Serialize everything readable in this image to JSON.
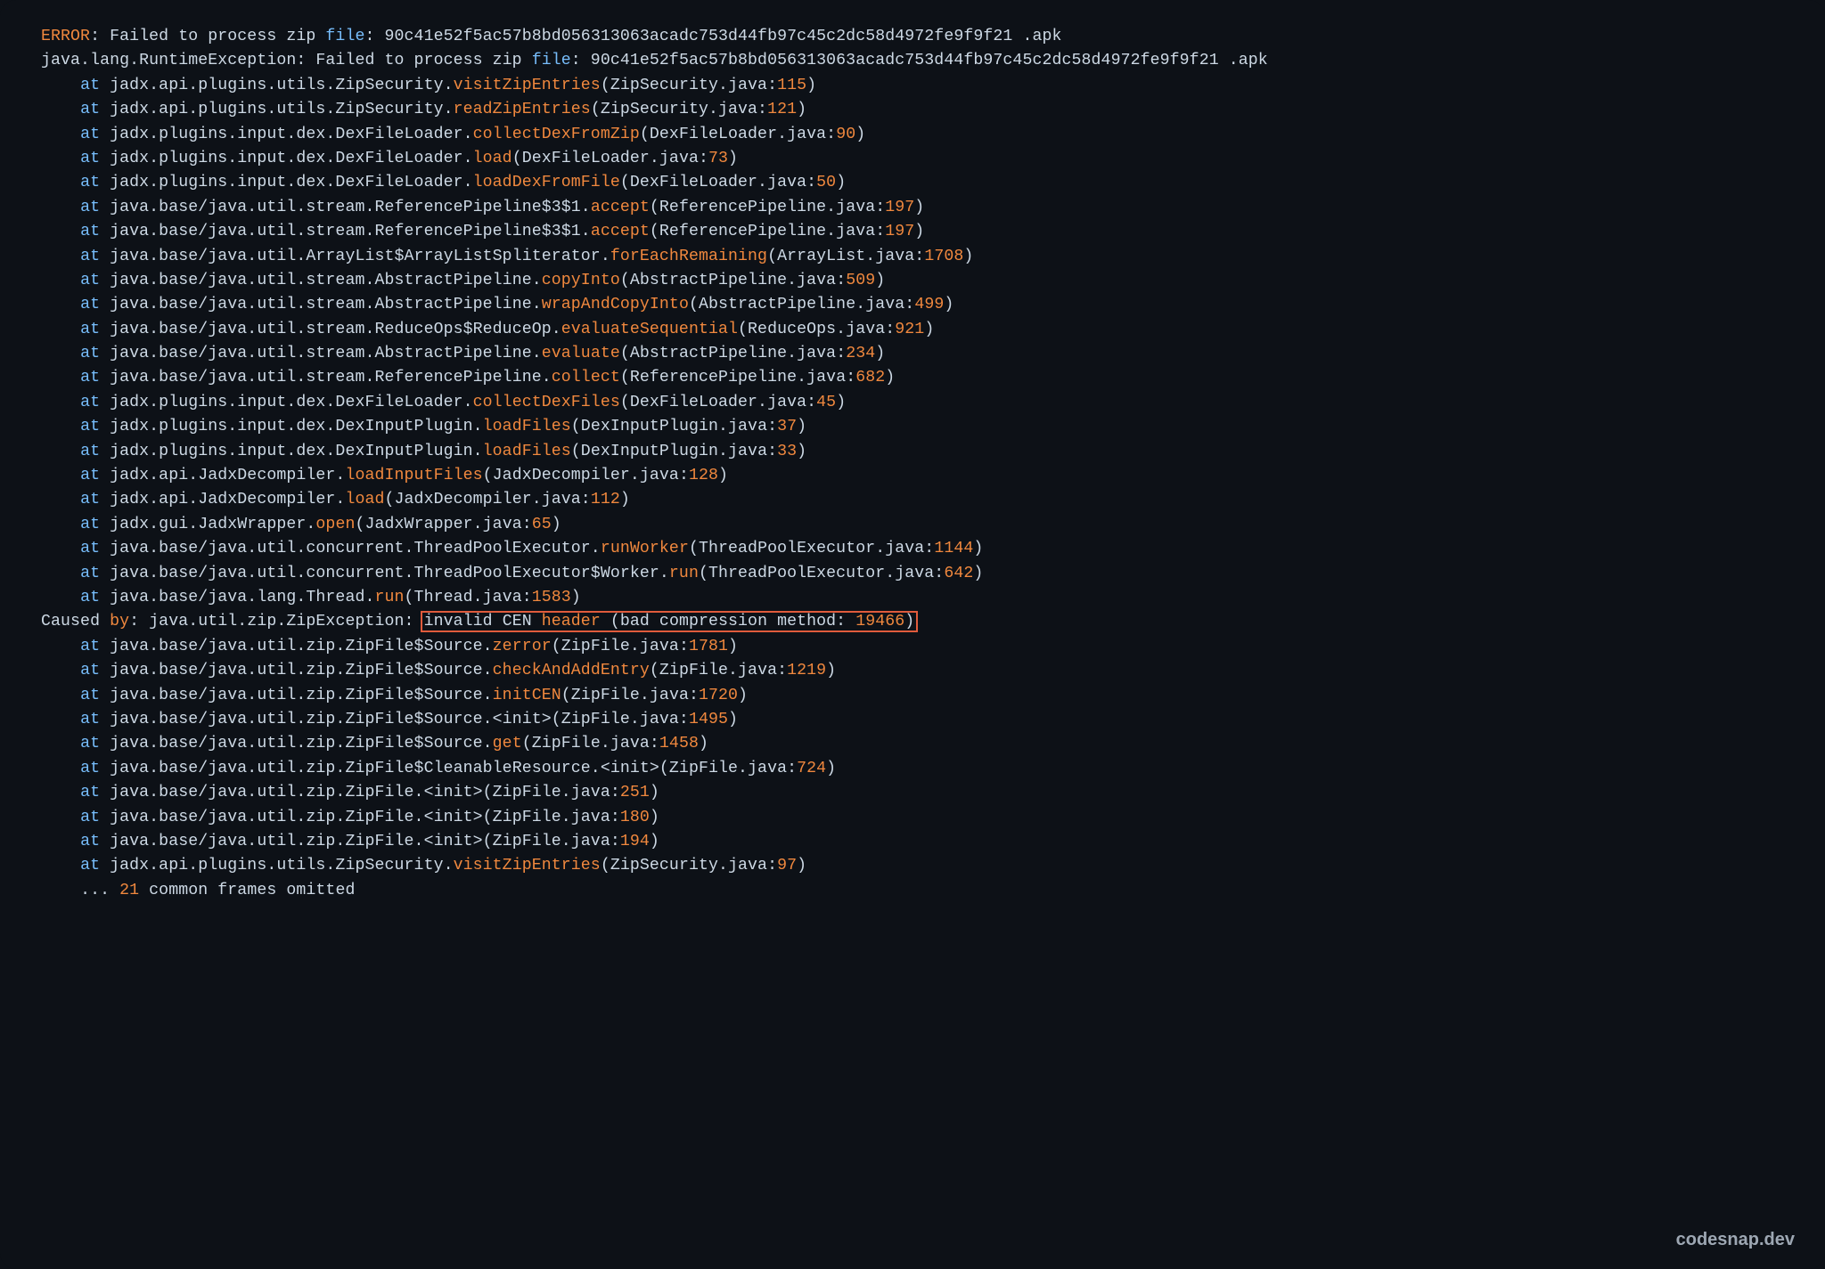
{
  "watermark": "codesnap.dev",
  "lines": [
    {
      "indent": 0,
      "segments": [
        {
          "t": "ERROR",
          "c": "kw1"
        },
        {
          "t": ": Failed to process zip ",
          "c": "txt"
        },
        {
          "t": "file",
          "c": "special"
        },
        {
          "t": ": 90c41e52f5ac57b8bd056313063acadc753d44fb97c45c2dc58d4972fe9f9f21 .apk",
          "c": "txt"
        }
      ]
    },
    {
      "indent": 0,
      "segments": [
        {
          "t": "java.lang.RuntimeException: Failed to process zip ",
          "c": "txt"
        },
        {
          "t": "file",
          "c": "special"
        },
        {
          "t": ": 90c41e52f5ac57b8bd056313063acadc753d44fb97c45c2dc58d4972fe9f9f21 .apk",
          "c": "txt"
        }
      ]
    },
    {
      "indent": 1,
      "segments": [
        {
          "t": "at",
          "c": "special"
        },
        {
          "t": " jadx.api.plugins.utils.ZipSecurity.",
          "c": "txt"
        },
        {
          "t": "visitZipEntries",
          "c": "meth"
        },
        {
          "t": "(ZipSecurity.java:",
          "c": "txt"
        },
        {
          "t": "115",
          "c": "num"
        },
        {
          "t": ")",
          "c": "txt"
        }
      ]
    },
    {
      "indent": 1,
      "segments": [
        {
          "t": "at",
          "c": "special"
        },
        {
          "t": " jadx.api.plugins.utils.ZipSecurity.",
          "c": "txt"
        },
        {
          "t": "readZipEntries",
          "c": "meth"
        },
        {
          "t": "(ZipSecurity.java:",
          "c": "txt"
        },
        {
          "t": "121",
          "c": "num"
        },
        {
          "t": ")",
          "c": "txt"
        }
      ]
    },
    {
      "indent": 1,
      "segments": [
        {
          "t": "at",
          "c": "special"
        },
        {
          "t": " jadx.plugins.input.dex.DexFileLoader.",
          "c": "txt"
        },
        {
          "t": "collectDexFromZip",
          "c": "meth"
        },
        {
          "t": "(DexFileLoader.java:",
          "c": "txt"
        },
        {
          "t": "90",
          "c": "num"
        },
        {
          "t": ")",
          "c": "txt"
        }
      ]
    },
    {
      "indent": 1,
      "segments": [
        {
          "t": "at",
          "c": "special"
        },
        {
          "t": " jadx.plugins.input.dex.DexFileLoader.",
          "c": "txt"
        },
        {
          "t": "load",
          "c": "meth"
        },
        {
          "t": "(DexFileLoader.java:",
          "c": "txt"
        },
        {
          "t": "73",
          "c": "num"
        },
        {
          "t": ")",
          "c": "txt"
        }
      ]
    },
    {
      "indent": 1,
      "segments": [
        {
          "t": "at",
          "c": "special"
        },
        {
          "t": " jadx.plugins.input.dex.DexFileLoader.",
          "c": "txt"
        },
        {
          "t": "loadDexFromFile",
          "c": "meth"
        },
        {
          "t": "(DexFileLoader.java:",
          "c": "txt"
        },
        {
          "t": "50",
          "c": "num"
        },
        {
          "t": ")",
          "c": "txt"
        }
      ]
    },
    {
      "indent": 1,
      "segments": [
        {
          "t": "at",
          "c": "special"
        },
        {
          "t": " java.base/java.util.stream.ReferencePipeline$3$1.",
          "c": "txt"
        },
        {
          "t": "accept",
          "c": "meth"
        },
        {
          "t": "(ReferencePipeline.java:",
          "c": "txt"
        },
        {
          "t": "197",
          "c": "num"
        },
        {
          "t": ")",
          "c": "txt"
        }
      ]
    },
    {
      "indent": 1,
      "segments": [
        {
          "t": "at",
          "c": "special"
        },
        {
          "t": " java.base/java.util.stream.ReferencePipeline$3$1.",
          "c": "txt"
        },
        {
          "t": "accept",
          "c": "meth"
        },
        {
          "t": "(ReferencePipeline.java:",
          "c": "txt"
        },
        {
          "t": "197",
          "c": "num"
        },
        {
          "t": ")",
          "c": "txt"
        }
      ]
    },
    {
      "indent": 1,
      "segments": [
        {
          "t": "at",
          "c": "special"
        },
        {
          "t": " java.base/java.util.ArrayList$ArrayListSpliterator.",
          "c": "txt"
        },
        {
          "t": "forEachRemaining",
          "c": "meth"
        },
        {
          "t": "(ArrayList.java:",
          "c": "txt"
        },
        {
          "t": "1708",
          "c": "num"
        },
        {
          "t": ")",
          "c": "txt"
        }
      ]
    },
    {
      "indent": 1,
      "segments": [
        {
          "t": "at",
          "c": "special"
        },
        {
          "t": " java.base/java.util.stream.AbstractPipeline.",
          "c": "txt"
        },
        {
          "t": "copyInto",
          "c": "meth"
        },
        {
          "t": "(AbstractPipeline.java:",
          "c": "txt"
        },
        {
          "t": "509",
          "c": "num"
        },
        {
          "t": ")",
          "c": "txt"
        }
      ]
    },
    {
      "indent": 1,
      "segments": [
        {
          "t": "at",
          "c": "special"
        },
        {
          "t": " java.base/java.util.stream.AbstractPipeline.",
          "c": "txt"
        },
        {
          "t": "wrapAndCopyInto",
          "c": "meth"
        },
        {
          "t": "(AbstractPipeline.java:",
          "c": "txt"
        },
        {
          "t": "499",
          "c": "num"
        },
        {
          "t": ")",
          "c": "txt"
        }
      ]
    },
    {
      "indent": 1,
      "segments": [
        {
          "t": "at",
          "c": "special"
        },
        {
          "t": " java.base/java.util.stream.ReduceOps$ReduceOp.",
          "c": "txt"
        },
        {
          "t": "evaluateSequential",
          "c": "meth"
        },
        {
          "t": "(ReduceOps.java:",
          "c": "txt"
        },
        {
          "t": "921",
          "c": "num"
        },
        {
          "t": ")",
          "c": "txt"
        }
      ]
    },
    {
      "indent": 1,
      "segments": [
        {
          "t": "at",
          "c": "special"
        },
        {
          "t": " java.base/java.util.stream.AbstractPipeline.",
          "c": "txt"
        },
        {
          "t": "evaluate",
          "c": "meth"
        },
        {
          "t": "(AbstractPipeline.java:",
          "c": "txt"
        },
        {
          "t": "234",
          "c": "num"
        },
        {
          "t": ")",
          "c": "txt"
        }
      ]
    },
    {
      "indent": 1,
      "segments": [
        {
          "t": "at",
          "c": "special"
        },
        {
          "t": " java.base/java.util.stream.ReferencePipeline.",
          "c": "txt"
        },
        {
          "t": "collect",
          "c": "meth"
        },
        {
          "t": "(ReferencePipeline.java:",
          "c": "txt"
        },
        {
          "t": "682",
          "c": "num"
        },
        {
          "t": ")",
          "c": "txt"
        }
      ]
    },
    {
      "indent": 1,
      "segments": [
        {
          "t": "at",
          "c": "special"
        },
        {
          "t": " jadx.plugins.input.dex.DexFileLoader.",
          "c": "txt"
        },
        {
          "t": "collectDexFiles",
          "c": "meth"
        },
        {
          "t": "(DexFileLoader.java:",
          "c": "txt"
        },
        {
          "t": "45",
          "c": "num"
        },
        {
          "t": ")",
          "c": "txt"
        }
      ]
    },
    {
      "indent": 1,
      "segments": [
        {
          "t": "at",
          "c": "special"
        },
        {
          "t": " jadx.plugins.input.dex.DexInputPlugin.",
          "c": "txt"
        },
        {
          "t": "loadFiles",
          "c": "meth"
        },
        {
          "t": "(DexInputPlugin.java:",
          "c": "txt"
        },
        {
          "t": "37",
          "c": "num"
        },
        {
          "t": ")",
          "c": "txt"
        }
      ]
    },
    {
      "indent": 1,
      "segments": [
        {
          "t": "at",
          "c": "special"
        },
        {
          "t": " jadx.plugins.input.dex.DexInputPlugin.",
          "c": "txt"
        },
        {
          "t": "loadFiles",
          "c": "meth"
        },
        {
          "t": "(DexInputPlugin.java:",
          "c": "txt"
        },
        {
          "t": "33",
          "c": "num"
        },
        {
          "t": ")",
          "c": "txt"
        }
      ]
    },
    {
      "indent": 1,
      "segments": [
        {
          "t": "at",
          "c": "special"
        },
        {
          "t": " jadx.api.JadxDecompiler.",
          "c": "txt"
        },
        {
          "t": "loadInputFiles",
          "c": "meth"
        },
        {
          "t": "(JadxDecompiler.java:",
          "c": "txt"
        },
        {
          "t": "128",
          "c": "num"
        },
        {
          "t": ")",
          "c": "txt"
        }
      ]
    },
    {
      "indent": 1,
      "segments": [
        {
          "t": "at",
          "c": "special"
        },
        {
          "t": " jadx.api.JadxDecompiler.",
          "c": "txt"
        },
        {
          "t": "load",
          "c": "meth"
        },
        {
          "t": "(JadxDecompiler.java:",
          "c": "txt"
        },
        {
          "t": "112",
          "c": "num"
        },
        {
          "t": ")",
          "c": "txt"
        }
      ]
    },
    {
      "indent": 1,
      "segments": [
        {
          "t": "at",
          "c": "special"
        },
        {
          "t": " jadx.gui.JadxWrapper.",
          "c": "txt"
        },
        {
          "t": "open",
          "c": "meth"
        },
        {
          "t": "(JadxWrapper.java:",
          "c": "txt"
        },
        {
          "t": "65",
          "c": "num"
        },
        {
          "t": ")",
          "c": "txt"
        }
      ]
    },
    {
      "indent": 1,
      "segments": [
        {
          "t": "at",
          "c": "special"
        },
        {
          "t": " java.base/java.util.concurrent.ThreadPoolExecutor.",
          "c": "txt"
        },
        {
          "t": "runWorker",
          "c": "meth"
        },
        {
          "t": "(ThreadPoolExecutor.java:",
          "c": "txt"
        },
        {
          "t": "1144",
          "c": "num"
        },
        {
          "t": ")",
          "c": "txt"
        }
      ]
    },
    {
      "indent": 1,
      "segments": [
        {
          "t": "at",
          "c": "special"
        },
        {
          "t": " java.base/java.util.concurrent.ThreadPoolExecutor$Worker.",
          "c": "txt"
        },
        {
          "t": "run",
          "c": "meth"
        },
        {
          "t": "(ThreadPoolExecutor.java:",
          "c": "txt"
        },
        {
          "t": "642",
          "c": "num"
        },
        {
          "t": ")",
          "c": "txt"
        }
      ]
    },
    {
      "indent": 1,
      "segments": [
        {
          "t": "at",
          "c": "special"
        },
        {
          "t": " java.base/java.lang.Thread.",
          "c": "txt"
        },
        {
          "t": "run",
          "c": "meth"
        },
        {
          "t": "(Thread.java:",
          "c": "txt"
        },
        {
          "t": "1583",
          "c": "num"
        },
        {
          "t": ")",
          "c": "txt"
        }
      ]
    },
    {
      "indent": 0,
      "segments": [
        {
          "t": "Caused ",
          "c": "txt"
        },
        {
          "t": "by",
          "c": "kw1"
        },
        {
          "t": ": java.util.zip.ZipException: ",
          "c": "txt"
        },
        {
          "t": "invalid CEN ",
          "c": "txt",
          "boxstart": true
        },
        {
          "t": "header",
          "c": "kw1"
        },
        {
          "t": " (bad compression method: ",
          "c": "txt"
        },
        {
          "t": "19466",
          "c": "num"
        },
        {
          "t": ")",
          "c": "txt",
          "boxend": true
        }
      ]
    },
    {
      "indent": 1,
      "segments": [
        {
          "t": "at",
          "c": "special"
        },
        {
          "t": " java.base/java.util.zip.ZipFile$Source.",
          "c": "txt"
        },
        {
          "t": "zerror",
          "c": "meth"
        },
        {
          "t": "(ZipFile.java:",
          "c": "txt"
        },
        {
          "t": "1781",
          "c": "num"
        },
        {
          "t": ")",
          "c": "txt"
        }
      ]
    },
    {
      "indent": 1,
      "segments": [
        {
          "t": "at",
          "c": "special"
        },
        {
          "t": " java.base/java.util.zip.ZipFile$Source.",
          "c": "txt"
        },
        {
          "t": "checkAndAddEntry",
          "c": "meth"
        },
        {
          "t": "(ZipFile.java:",
          "c": "txt"
        },
        {
          "t": "1219",
          "c": "num"
        },
        {
          "t": ")",
          "c": "txt"
        }
      ]
    },
    {
      "indent": 1,
      "segments": [
        {
          "t": "at",
          "c": "special"
        },
        {
          "t": " java.base/java.util.zip.ZipFile$Source.",
          "c": "txt"
        },
        {
          "t": "initCEN",
          "c": "meth"
        },
        {
          "t": "(ZipFile.java:",
          "c": "txt"
        },
        {
          "t": "1720",
          "c": "num"
        },
        {
          "t": ")",
          "c": "txt"
        }
      ]
    },
    {
      "indent": 1,
      "segments": [
        {
          "t": "at",
          "c": "special"
        },
        {
          "t": " java.base/java.util.zip.ZipFile$Source.<init>(ZipFile.java:",
          "c": "txt"
        },
        {
          "t": "1495",
          "c": "num"
        },
        {
          "t": ")",
          "c": "txt"
        }
      ]
    },
    {
      "indent": 1,
      "segments": [
        {
          "t": "at",
          "c": "special"
        },
        {
          "t": " java.base/java.util.zip.ZipFile$Source.",
          "c": "txt"
        },
        {
          "t": "get",
          "c": "meth"
        },
        {
          "t": "(ZipFile.java:",
          "c": "txt"
        },
        {
          "t": "1458",
          "c": "num"
        },
        {
          "t": ")",
          "c": "txt"
        }
      ]
    },
    {
      "indent": 1,
      "segments": [
        {
          "t": "at",
          "c": "special"
        },
        {
          "t": " java.base/java.util.zip.ZipFile$CleanableResource.<init>(ZipFile.java:",
          "c": "txt"
        },
        {
          "t": "724",
          "c": "num"
        },
        {
          "t": ")",
          "c": "txt"
        }
      ]
    },
    {
      "indent": 1,
      "segments": [
        {
          "t": "at",
          "c": "special"
        },
        {
          "t": " java.base/java.util.zip.ZipFile.<init>(ZipFile.java:",
          "c": "txt"
        },
        {
          "t": "251",
          "c": "num"
        },
        {
          "t": ")",
          "c": "txt"
        }
      ]
    },
    {
      "indent": 1,
      "segments": [
        {
          "t": "at",
          "c": "special"
        },
        {
          "t": " java.base/java.util.zip.ZipFile.<init>(ZipFile.java:",
          "c": "txt"
        },
        {
          "t": "180",
          "c": "num"
        },
        {
          "t": ")",
          "c": "txt"
        }
      ]
    },
    {
      "indent": 1,
      "segments": [
        {
          "t": "at",
          "c": "special"
        },
        {
          "t": " java.base/java.util.zip.ZipFile.<init>(ZipFile.java:",
          "c": "txt"
        },
        {
          "t": "194",
          "c": "num"
        },
        {
          "t": ")",
          "c": "txt"
        }
      ]
    },
    {
      "indent": 1,
      "segments": [
        {
          "t": "at",
          "c": "special"
        },
        {
          "t": " jadx.api.plugins.utils.ZipSecurity.",
          "c": "txt"
        },
        {
          "t": "visitZipEntries",
          "c": "meth"
        },
        {
          "t": "(ZipSecurity.java:",
          "c": "txt"
        },
        {
          "t": "97",
          "c": "num"
        },
        {
          "t": ")",
          "c": "txt"
        }
      ]
    },
    {
      "indent": 1,
      "segments": [
        {
          "t": "... ",
          "c": "txt"
        },
        {
          "t": "21",
          "c": "num"
        },
        {
          "t": " common frames omitted",
          "c": "txt"
        }
      ]
    }
  ]
}
